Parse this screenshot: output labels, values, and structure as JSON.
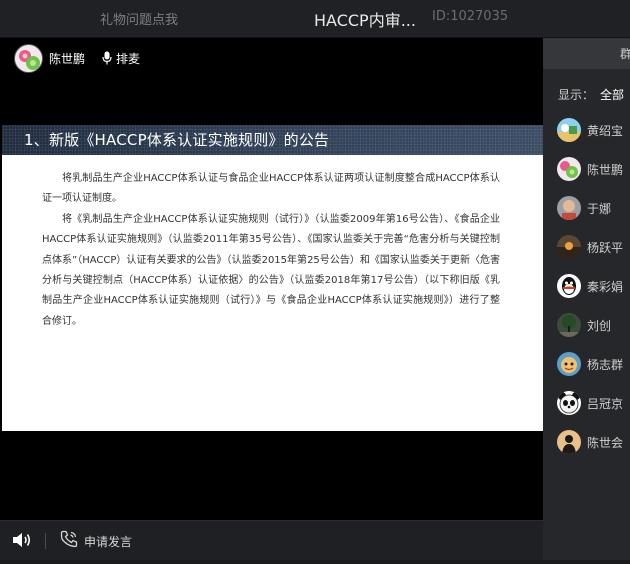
{
  "topbar": {
    "gift_link": "礼物问题点我",
    "room_title": "HACCP内审...",
    "room_id": "ID:1027035"
  },
  "presenter": {
    "name": "陈世鹏",
    "wheat_label": "排麦"
  },
  "slide": {
    "title": "1、新版《HACCP体系认证实施规则》的公告",
    "paragraph1": "将乳制品生产企业HACCP体系认证与食品企业HACCP体系认证两项认证制度整合成HACCP体系认证一项认证制度。",
    "paragraph2": "将《乳制品生产企业HACCP体系认证实施规则（试行）》（认监委2009年第16号公告）、《食品企业HACCP体系认证实施规则》（认监委2011年第35号公告）、《国家认监委关于完善“危害分析与关键控制点体系”（HACCP）认证有关要求的公告》（认监委2015年第25号公告）和《国家认监委关于更新〈危害分析与关键控制点（HACCP体系）认证依据〉的公告》（认监委2018年第17号公告）（以下称旧版《乳制品生产企业HACCP体系认证实施规则（试行）》与《食品企业HACCP体系认证实施规则》）进行了整合修订。"
  },
  "bottombar": {
    "speak_label": "申请发言"
  },
  "panel": {
    "group_tab": "群",
    "display_label": "显示：",
    "display_value": "全部",
    "members": [
      {
        "name": "黄绍宝",
        "avatar": "landscape"
      },
      {
        "name": "陈世鹏",
        "avatar": "flower"
      },
      {
        "name": "于娜",
        "avatar": "photo"
      },
      {
        "name": "杨跃平",
        "avatar": "sunset"
      },
      {
        "name": "秦彩娟",
        "avatar": "qq-penguin"
      },
      {
        "name": "刘创",
        "avatar": "tree"
      },
      {
        "name": "杨志群",
        "avatar": "cartoon"
      },
      {
        "name": "吕冠京",
        "avatar": "panda"
      },
      {
        "name": "陈世会",
        "avatar": "silhouette"
      }
    ]
  },
  "colors": {
    "stage_bg": "#000000",
    "topbar_bg": "#202124",
    "panel_bg": "#26272a",
    "slide_header": "#2e3e55"
  }
}
